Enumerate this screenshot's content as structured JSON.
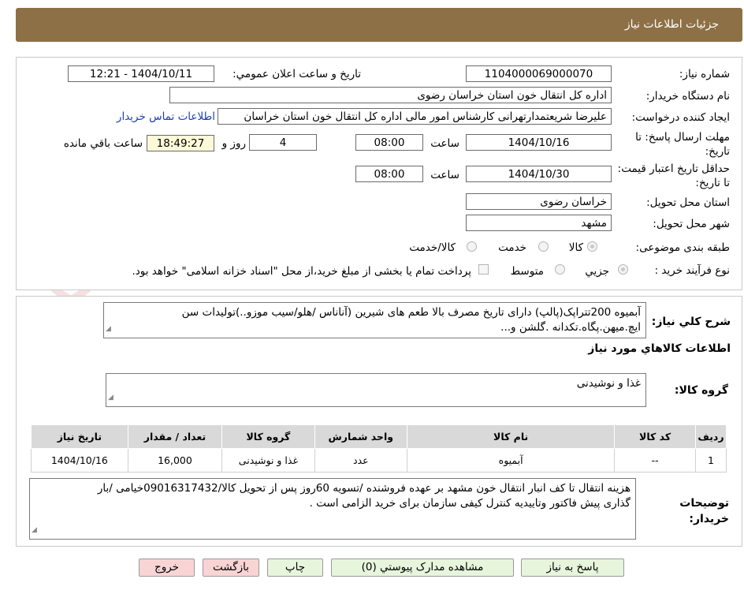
{
  "header": {
    "title": "جزئیات اطلاعات نیاز"
  },
  "need_number": {
    "label": "شماره نیاز:",
    "value": "1104000069000070"
  },
  "announce_datetime": {
    "label": "تاریخ و ساعت اعلان عمومي:",
    "value": "1404/10/11 - 12:21"
  },
  "buyer_org": {
    "label": "نام دستگاه خریدار:",
    "value": "اداره کل انتقال خون استان خراسان رضوی"
  },
  "requester": {
    "label": "ایجاد کننده درخواست:",
    "value": "علیرضا شریعتمدارتهرانی کارشناس امور مالی اداره کل انتقال خون استان خراسان",
    "contact_link": "اطلاعات تماس خریدار"
  },
  "send_deadline": {
    "label": "مهلت ارسال پاسخ: تا تاریخ:",
    "date": "1404/10/16",
    "time_label": "ساعت",
    "time": "08:00",
    "days": "4",
    "days_label": "روز و",
    "remaining": "18:49:27",
    "remaining_label": "ساعت باقي مانده"
  },
  "price_validity": {
    "label": "حداقل تاریخ اعتبار قیمت: تا تاریخ:",
    "date": "1404/10/30",
    "time_label": "ساعت",
    "time": "08:00"
  },
  "delivery_province": {
    "label": "استان محل تحویل:",
    "value": "خراسان رضوی"
  },
  "delivery_city": {
    "label": "شهر محل تحویل:",
    "value": "مشهد"
  },
  "category": {
    "label": "طبقه بندی موضوعی:",
    "options": [
      "کالا",
      "خدمت",
      "کالا/خدمت"
    ]
  },
  "process_type": {
    "label": "نوع فرآیند خرید :",
    "options": [
      "جزیي",
      "متوسط"
    ],
    "payment_note": "پرداخت تمام یا بخشی از مبلغ خرید،از محل \"اسناد خزانه اسلامی\" خواهد بود."
  },
  "description": {
    "label": "شرح کلي نیاز:",
    "line1": "آبمیوه 200تتراپک(پالپ) دارای تاریخ مصرف بالا طعم های شیرین (آناناس /هلو/سیب موزو..)تولیدات سن",
    "line2": "ایچ.میهن.پگاه.تکدانه .گلشن و..."
  },
  "goods_section": {
    "title": "اطلاعات کالاهاي مورد نیاز"
  },
  "goods_group": {
    "label": "گروه کالا:",
    "value": "غذا و نوشیدنی"
  },
  "goods_table": {
    "headers": [
      "ردیف",
      "کد کالا",
      "نام کالا",
      "واحد شمارش",
      "گروه کالا",
      "تعداد / مقدار",
      "تاریخ نیاز"
    ],
    "rows": [
      [
        "1",
        "--",
        "آبمیوه",
        "عدد",
        "غذا و نوشیدنی",
        "16,000",
        "1404/10/16"
      ]
    ]
  },
  "buyer_notes": {
    "label": "توضیحات خریدار:",
    "line1": "هزینه انتقال تا کف انبار انتقال خون مشهد بر عهده فروشنده /تسویه 60روز پس از تحویل کالا/09016317432خیامی /بار",
    "line2": "گذاری پیش فاکتور وتاییدیه کنترل کیفی سازمان برای خرید الزامی است ."
  },
  "buttons": {
    "reply": "پاسخ به نیاز",
    "attachments": "مشاهده مدارک پیوستي (0)",
    "print": "چاپ",
    "back": "بازگشت",
    "exit": "خروج"
  },
  "watermark": {
    "text": "AriaTender.neT"
  },
  "colors": {
    "header": "#8e7046",
    "button_green": "#e6f5dc",
    "button_pink": "#f9d4d4",
    "link": "#1a3fb5"
  }
}
